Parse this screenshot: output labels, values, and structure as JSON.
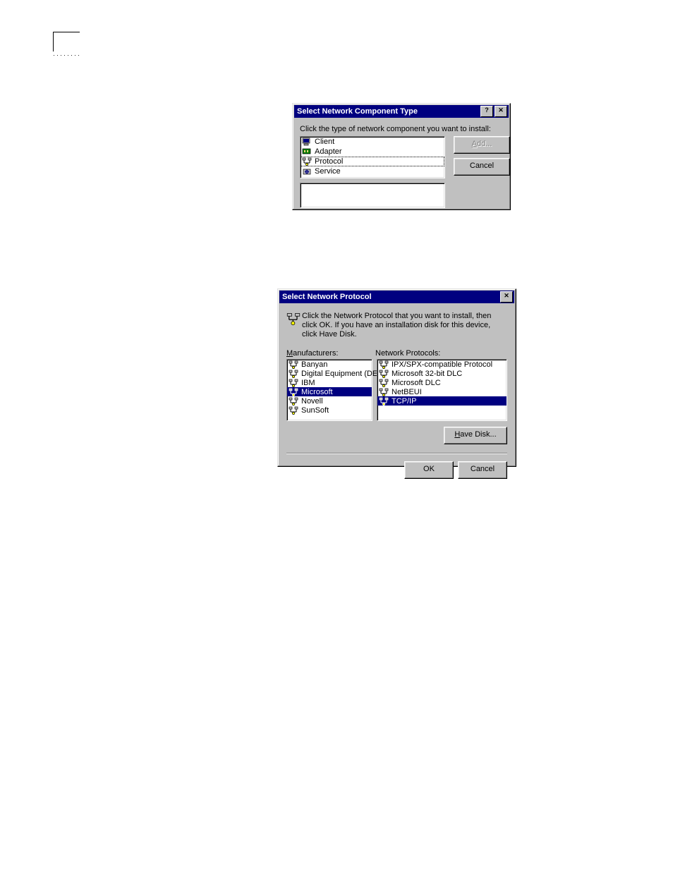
{
  "dlg1": {
    "title": "Select Network Component Type",
    "prompt": "Click the type of network component you want to install:",
    "items": [
      {
        "label": "Client",
        "icon": "client-icon"
      },
      {
        "label": "Adapter",
        "icon": "adapter-icon"
      },
      {
        "label": "Protocol",
        "icon": "protocol-icon",
        "selected": true
      },
      {
        "label": "Service",
        "icon": "service-icon"
      }
    ],
    "add_label": "Add...",
    "cancel_label": "Cancel"
  },
  "dlg2": {
    "title": "Select Network Protocol",
    "info": "Click the Network Protocol that you want to install, then click OK. If you have an installation disk for this device, click Have Disk.",
    "manufacturers_label": "Manufacturers:",
    "protocols_label": "Network Protocols:",
    "manufacturers": [
      {
        "label": "Banyan"
      },
      {
        "label": "Digital Equipment (DEC)"
      },
      {
        "label": "IBM"
      },
      {
        "label": "Microsoft",
        "selected": true
      },
      {
        "label": "Novell"
      },
      {
        "label": "SunSoft"
      }
    ],
    "protocols": [
      {
        "label": "IPX/SPX-compatible Protocol"
      },
      {
        "label": "Microsoft 32-bit DLC"
      },
      {
        "label": "Microsoft DLC"
      },
      {
        "label": "NetBEUI"
      },
      {
        "label": "TCP/IP",
        "selected": true
      }
    ],
    "have_disk_label": "Have Disk...",
    "ok_label": "OK",
    "cancel_label": "Cancel"
  }
}
